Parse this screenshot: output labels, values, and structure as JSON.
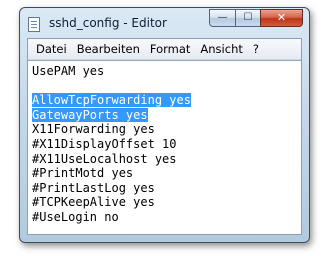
{
  "window": {
    "title": "sshd_config - Editor",
    "buttons": {
      "minimize": "—",
      "maximize": "☐",
      "close": "✕"
    }
  },
  "menu": [
    {
      "label": "Datei"
    },
    {
      "label": "Bearbeiten"
    },
    {
      "label": "Format"
    },
    {
      "label": "Ansicht"
    },
    {
      "label": "?"
    }
  ],
  "editor": {
    "lines": [
      {
        "text": "UsePAM yes",
        "selected": false
      },
      {
        "text": "",
        "selected": false
      },
      {
        "text": "AllowTcpForwarding yes",
        "selected": true
      },
      {
        "text": "GatewayPorts yes",
        "selected": true
      },
      {
        "text": "X11Forwarding yes",
        "selected": false
      },
      {
        "text": "#X11DisplayOffset 10",
        "selected": false
      },
      {
        "text": "#X11UseLocalhost yes",
        "selected": false
      },
      {
        "text": "#PrintMotd yes",
        "selected": false
      },
      {
        "text": "#PrintLastLog yes",
        "selected": false
      },
      {
        "text": "#TCPKeepAlive yes",
        "selected": false
      },
      {
        "text": "#UseLogin no",
        "selected": false
      }
    ]
  },
  "colors": {
    "selection": "#3399ff",
    "selection_text": "#ffffff",
    "close_button": "#c8452a"
  }
}
